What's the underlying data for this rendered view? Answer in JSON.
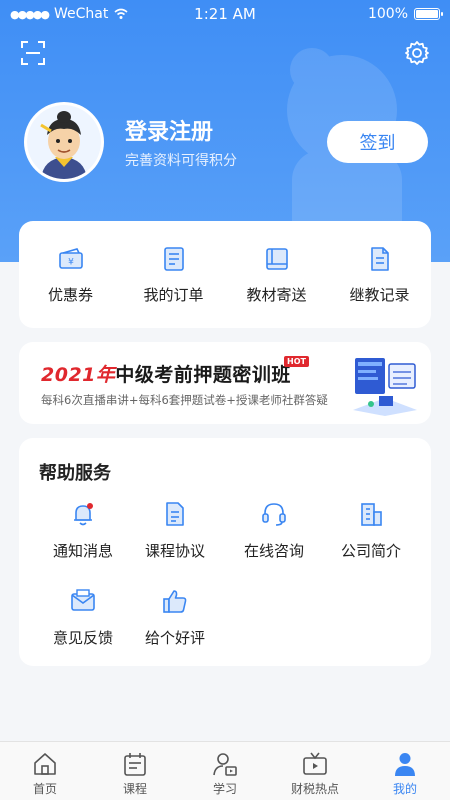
{
  "status_bar": {
    "carrier": "WeChat",
    "time": "1:21 AM",
    "battery": "100%"
  },
  "profile": {
    "title": "登录注册",
    "subtitle": "完善资料可得积分",
    "checkin_label": "签到"
  },
  "quick_links": [
    {
      "label": "优惠券",
      "icon": "coupon-icon"
    },
    {
      "label": "我的订单",
      "icon": "order-icon"
    },
    {
      "label": "教材寄送",
      "icon": "book-icon"
    },
    {
      "label": "继教记录",
      "icon": "record-icon"
    }
  ],
  "banner": {
    "year": "2021年",
    "title": "中级考前押题密训班",
    "hot": "HOT",
    "subtitle": "每科6次直播串讲+每科6套押题试卷+授课老师社群答疑"
  },
  "help": {
    "title": "帮助服务",
    "items": [
      {
        "label": "通知消息",
        "icon": "bell-icon"
      },
      {
        "label": "课程协议",
        "icon": "document-icon"
      },
      {
        "label": "在线咨询",
        "icon": "headset-icon"
      },
      {
        "label": "公司简介",
        "icon": "building-icon"
      },
      {
        "label": "意见反馈",
        "icon": "mail-icon"
      },
      {
        "label": "给个好评",
        "icon": "thumbs-up-icon"
      }
    ]
  },
  "tabs": [
    {
      "label": "首页",
      "icon": "home-icon",
      "active": false
    },
    {
      "label": "课程",
      "icon": "calendar-icon",
      "active": false
    },
    {
      "label": "学习",
      "icon": "study-icon",
      "active": false
    },
    {
      "label": "财税热点",
      "icon": "tv-icon",
      "active": false
    },
    {
      "label": "我的",
      "icon": "user-icon",
      "active": true
    }
  ],
  "colors": {
    "primary": "#3a86f2",
    "header_top": "#3f8ef5",
    "header_bottom": "#5aa1f8",
    "accent_red": "#e0282e"
  }
}
